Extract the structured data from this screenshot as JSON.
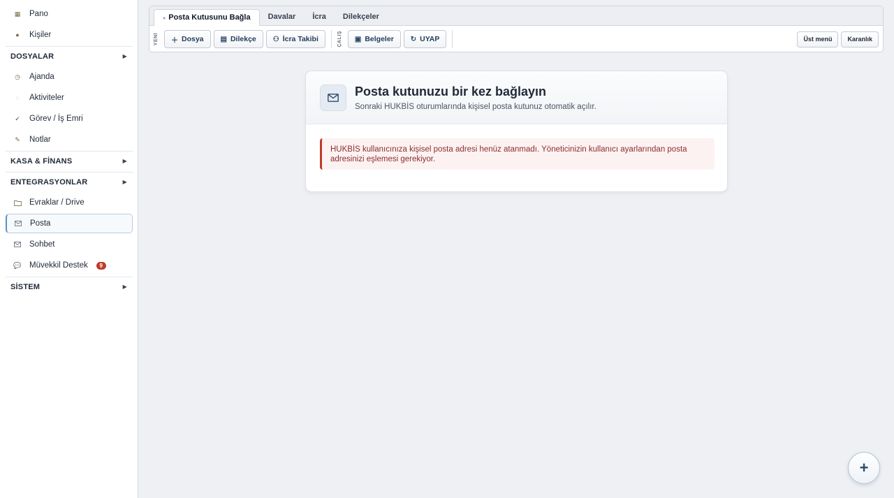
{
  "sidebar": {
    "pano": "Pano",
    "kisiler": "Kişiler",
    "dosyalar": "DOSYALAR",
    "ajanda": "Ajanda",
    "aktiviteler": "Aktiviteler",
    "gorev": "Görev / İş Emri",
    "notlar": "Notlar",
    "kasa": "KASA & FİNANS",
    "entegrasyonlar": "ENTEGRASYONLAR",
    "evraklar": "Evraklar / Drive",
    "posta": "Posta",
    "sohbet": "Sohbet",
    "muvekkil": "Müvekkil Destek",
    "muvekkil_badge": "9",
    "sistem": "SİSTEM",
    "arrow": "▶"
  },
  "tabs": [
    "Posta Kutusunu Bağla",
    "Davalar",
    "İcra",
    "Dilekçeler"
  ],
  "toolbar": {
    "group1_label": "YENİ",
    "dosya": "Dosya",
    "dilekce": "Dilekçe",
    "icra_takibi": "İcra Takibi",
    "group2_label": "ÇALIŞ",
    "belgeler": "Belgeler",
    "uyap": "UYAP",
    "ust_menu": "Üst menü",
    "karanlik": "Karanlık"
  },
  "card": {
    "title": "Posta kutunuzu bir kez bağlayın",
    "subtitle": "Sonraki HUKBİS oturumlarında kişisel posta kutunuz otomatik açılır.",
    "alert": "HUKBİS kullanıcınıza kişisel posta adresi henüz atanmadı. Yöneticinizin kullanıcı ayarlarından posta adresinizi eşlemesi gerekiyor."
  },
  "fab": "+",
  "colors": {
    "accent": "#5b8fc9",
    "alert_border": "#c0392b",
    "alert_bg": "#fdf2f2",
    "badge": "#c0392b"
  }
}
